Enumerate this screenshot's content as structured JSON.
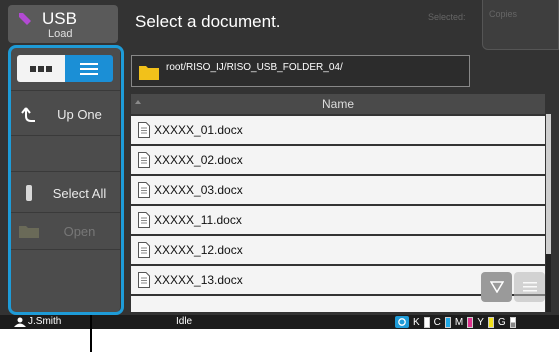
{
  "mode": {
    "title": "USB",
    "subtitle": "Load",
    "icon": "usb-pen-icon"
  },
  "header": {
    "title": "Select a document.",
    "selected_label": "Selected:",
    "copies_label": "Copies"
  },
  "sidebar": {
    "view_toggle": {
      "thumbnail_icon": "thumbnail-view-icon",
      "list_icon": "list-view-icon",
      "active": "list"
    },
    "buttons": [
      {
        "label": "Up One",
        "icon": "up-one-icon",
        "enabled": true
      },
      {
        "label": "Select All",
        "icon": "checkbox-icon",
        "enabled": true
      },
      {
        "label": "Open",
        "icon": "folder-icon",
        "enabled": false
      }
    ]
  },
  "path": {
    "text": "root/RISO_IJ/RISO_USB_FOLDER_04/",
    "icon": "folder-icon"
  },
  "list": {
    "column_header": "Name",
    "files": [
      {
        "name": "XXXXX_01.docx"
      },
      {
        "name": "XXXXX_02.docx"
      },
      {
        "name": "XXXXX_03.docx"
      },
      {
        "name": "XXXXX_11.docx"
      },
      {
        "name": "XXXXX_12.docx"
      },
      {
        "name": "XXXXX_13.docx"
      },
      {
        "name": ""
      }
    ]
  },
  "statusbar": {
    "user": "J.Smith",
    "status": "Idle",
    "ink": [
      {
        "label": "K",
        "color": "#111111",
        "fill": 0
      },
      {
        "label": "C",
        "color": "#1fa8e6",
        "fill": 1
      },
      {
        "label": "M",
        "color": "#e0338f",
        "fill": 1
      },
      {
        "label": "Y",
        "color": "#f3e21c",
        "fill": 1
      },
      {
        "label": "G",
        "color": "#888888",
        "fill": 0.5
      }
    ]
  },
  "colors": {
    "accent": "#1e9bd7",
    "usb": "#b24ad3"
  }
}
